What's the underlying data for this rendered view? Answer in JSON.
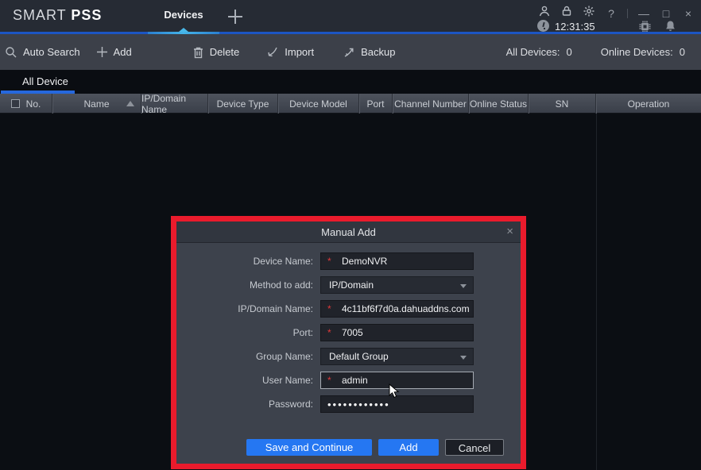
{
  "app": {
    "brand_light": "SMART ",
    "brand_bold": "PSS",
    "time": "12:31:35"
  },
  "titlebar": {
    "tab_devices": "Devices"
  },
  "icons": {
    "help": "?",
    "minimize": "—",
    "maximize": "□",
    "close": "×",
    "dialog_close": "×"
  },
  "toolbar": {
    "auto_search": "Auto Search",
    "add": "Add",
    "delete": "Delete",
    "import": "Import",
    "backup": "Backup",
    "all_devices_label": "All Devices:",
    "all_devices_count": "0",
    "online_devices_label": "Online Devices:",
    "online_devices_count": "0"
  },
  "device_tabs": {
    "all_device": "All Device"
  },
  "table": {
    "columns": [
      "No.",
      "Name",
      "IP/Domain Name",
      "Device Type",
      "Device Model",
      "Port",
      "Channel Number",
      "Online Status",
      "SN",
      "Operation"
    ],
    "rows": []
  },
  "dialog": {
    "title": "Manual Add",
    "required_marker": "*",
    "fields": [
      {
        "label": "Device Name:",
        "value": "DemoNVR",
        "type": "input",
        "required": true
      },
      {
        "label": "Method to add:",
        "value": "IP/Domain",
        "type": "select",
        "required": false
      },
      {
        "label": "IP/Domain Name:",
        "value": "4c11bf6f7d0a.dahuaddns.com",
        "type": "input",
        "required": true
      },
      {
        "label": "Port:",
        "value": "7005",
        "type": "input",
        "required": true
      },
      {
        "label": "Group Name:",
        "value": "Default Group",
        "type": "select",
        "required": false
      },
      {
        "label": "User Name:",
        "value": "admin",
        "type": "input",
        "required": true
      },
      {
        "label": "Password:",
        "value": "••••••••••••",
        "type": "password",
        "required": false
      }
    ],
    "buttons": {
      "save_continue": "Save and Continue",
      "add": "Add",
      "cancel": "Cancel"
    }
  },
  "colors": {
    "accent_blue": "#2577f2",
    "tab_underline": "#2668dd",
    "annotation_red": "#ea1b2c",
    "titlebar_bg": "#262b34",
    "toolbar_bg": "#3c4049",
    "table_body_bg": "#0b0e13",
    "dialog_bg": "#3d424c",
    "required_red": "#e03a3a"
  }
}
